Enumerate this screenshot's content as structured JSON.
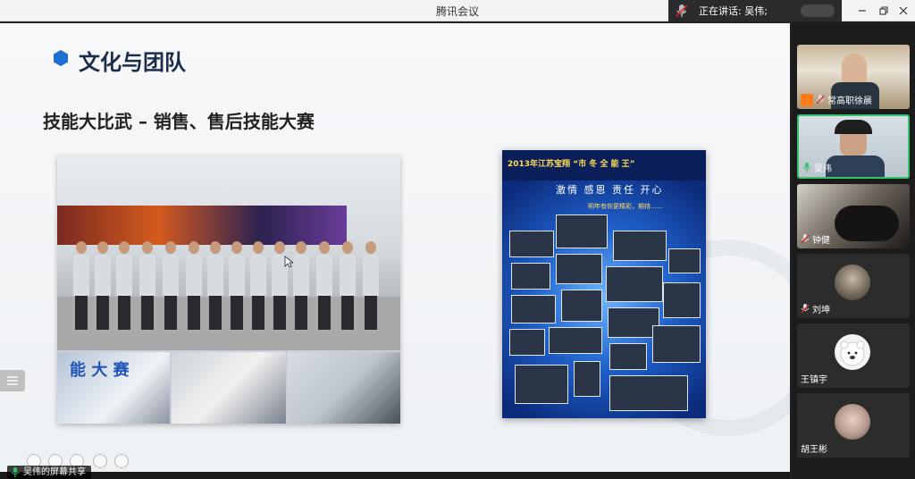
{
  "app": {
    "title": "腾讯会议"
  },
  "speaking": {
    "text": "正在讲话: 吴伟;"
  },
  "slide": {
    "title": "文化与团队",
    "subtitle": "技能大比武 – 销售、售后技能大赛",
    "collage_text": "能  大  赛",
    "poster_title": "2013年江苏宝翔  “市 冬 全 能 王”",
    "poster_slogan": "激情  感恩  责任  开心",
    "poster_note": "明年有你更精彩，期待……"
  },
  "share": {
    "label": "吴伟的屏幕共享"
  },
  "participants": [
    {
      "name": "常高职徐晨",
      "host": true,
      "mic": "muted",
      "active": false,
      "video": "office"
    },
    {
      "name": "吴伟",
      "host": false,
      "mic": "on",
      "active": true,
      "video": "face"
    },
    {
      "name": "钟健",
      "host": false,
      "mic": "muted",
      "active": false,
      "video": "dark"
    },
    {
      "name": "刘坤",
      "host": false,
      "mic": "muted",
      "active": false,
      "video": "avatar"
    },
    {
      "name": "王镇宇",
      "host": false,
      "mic": "none",
      "active": false,
      "video": "avatar-bear"
    },
    {
      "name": "胡王彬",
      "host": false,
      "mic": "none",
      "active": false,
      "video": "avatar-girl"
    }
  ],
  "colors": {
    "accent": "#1f6fd1",
    "active_border": "#35c46d",
    "mic_muted": "#e02020",
    "mic_on": "#35c46d"
  }
}
